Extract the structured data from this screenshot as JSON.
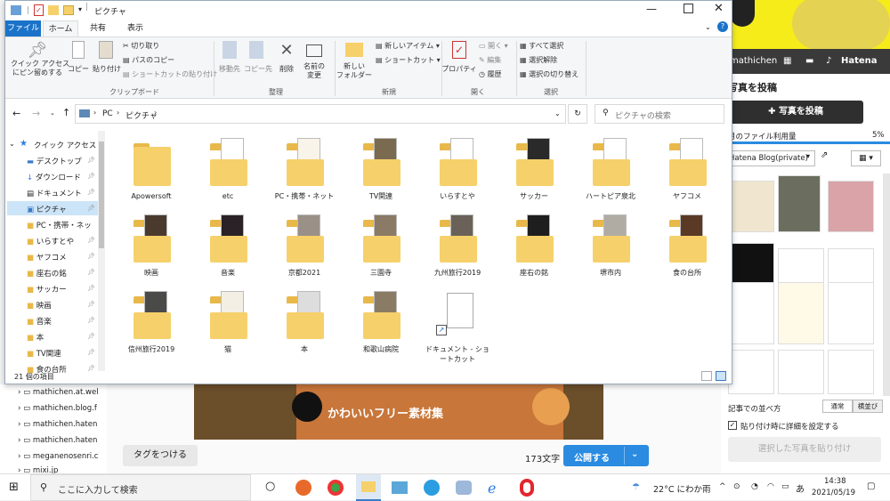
{
  "explorer": {
    "title": "ピクチャ",
    "tabs": [
      "ファイル",
      "ホーム",
      "共有",
      "表示"
    ],
    "ribbon": {
      "clipboard": {
        "pin": "クイック アクセス\nにピン留めする",
        "copy": "コピー",
        "paste": "貼り付け",
        "cut": "切り取り",
        "copy_path": "パスのコピー",
        "paste_shortcut": "ショートカットの貼り付け",
        "group": "クリップボード"
      },
      "organize": {
        "move": "移動先",
        "copy_to": "コピー先",
        "delete": "削除",
        "rename": "名前の\n変更",
        "group": "整理"
      },
      "new": {
        "folder": "新しい\nフォルダー",
        "new_item": "新しいアイテム",
        "shortcut": "ショートカット",
        "group": "新規"
      },
      "open": {
        "properties": "プロパティ",
        "open": "開く",
        "edit": "編集",
        "history": "履歴",
        "group": "開く"
      },
      "select": {
        "all": "すべて選択",
        "none": "選択解除",
        "invert": "選択の切り替え",
        "group": "選択"
      }
    },
    "address": {
      "pc": "PC",
      "folder": "ピクチャ",
      "search_placeholder": "ピクチャの検索"
    },
    "nav": [
      {
        "label": "クイック アクセス"
      },
      {
        "label": "デスクトップ"
      },
      {
        "label": "ダウンロード"
      },
      {
        "label": "ドキュメント"
      },
      {
        "label": "ピクチャ"
      },
      {
        "label": "PC・携帯・ネッ"
      },
      {
        "label": "いらすとや"
      },
      {
        "label": "ヤフコメ"
      },
      {
        "label": "座右の銘"
      },
      {
        "label": "サッカー"
      },
      {
        "label": "映画"
      },
      {
        "label": "音楽"
      },
      {
        "label": "本"
      },
      {
        "label": "TV関連"
      },
      {
        "label": "食の台所"
      }
    ],
    "items": [
      {
        "name": "Apowersoft"
      },
      {
        "name": "etc"
      },
      {
        "name": "PC・携帯・ネット"
      },
      {
        "name": "TV関連"
      },
      {
        "name": "いらすとや"
      },
      {
        "name": "サッカー"
      },
      {
        "name": "ハートピア泉北"
      },
      {
        "name": "ヤフコメ"
      },
      {
        "name": "映画"
      },
      {
        "name": "音楽"
      },
      {
        "name": "京都2021"
      },
      {
        "name": "三園寺"
      },
      {
        "name": "九州旅行2019"
      },
      {
        "name": "座右の銘"
      },
      {
        "name": "堺市内"
      },
      {
        "name": "食の台所"
      },
      {
        "name": "信州旅行2019"
      },
      {
        "name": "猫"
      },
      {
        "name": "本"
      },
      {
        "name": "和歌山病院"
      },
      {
        "name": "ドキュメント - ショートカット"
      }
    ],
    "status": "21 個の項目"
  },
  "background": {
    "hatena_user": "mathichen",
    "hatena_brand": "Hatena",
    "post_photo_title": "写真を投稿",
    "post_photo_button": "写真を投稿",
    "file_usage_label": "月のファイル利用量",
    "file_usage_value": "5%",
    "blog_select": "Hatena Blog(private)",
    "sort_label": "記事での並べ方",
    "sort_normal": "通常",
    "sort_side": "横並び",
    "detail_checkbox": "貼り付け時に詳細を設定する",
    "paste_button": "選択した写真を貼り付け",
    "tree": [
      "mathichen.at.wel",
      "mathichen.blog.f",
      "mathichen.haten",
      "mathichen.haten",
      "meganenosenri.c",
      "mixi.jp"
    ],
    "tag_button": "タグをつける",
    "char_count": "173文字",
    "publish_button": "公開する",
    "banner_text": "かわいいフリー素材集"
  },
  "taskbar": {
    "search_placeholder": "ここに入力して検索",
    "weather": "22°C にわか雨",
    "time": "14:38",
    "date": "2021/05/19",
    "ime": "あ"
  },
  "colors": {
    "accent": "#1a73c9",
    "folder": "#f6d06a",
    "ribbon": "#f5f6f7",
    "publish": "#2a8be0"
  }
}
